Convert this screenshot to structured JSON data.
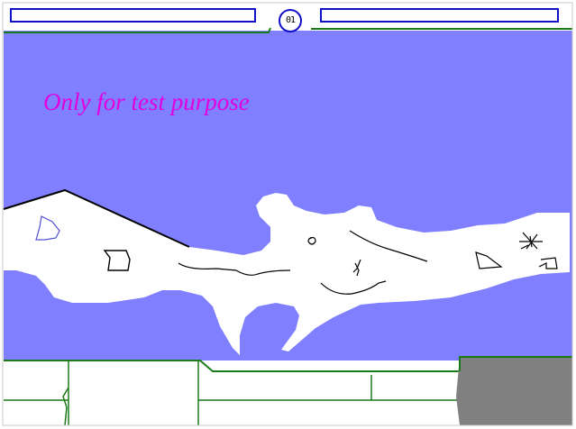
{
  "hud": {
    "left_bar": {
      "color": "#1010c8",
      "fill_level": 0.0
    },
    "right_bar": {
      "color": "#1010c8",
      "fill_level": 0.0
    },
    "center_button": {
      "label": "01",
      "icon": "mode-toggle-icon"
    }
  },
  "watermark": {
    "text": "Only for test purpose",
    "color": "#e000e0"
  },
  "colors": {
    "sky": "#7f7fff",
    "terrain": "#ffffff",
    "border": "#1a7a1a",
    "grey_block": "#808080",
    "accent": "#1010c8"
  }
}
